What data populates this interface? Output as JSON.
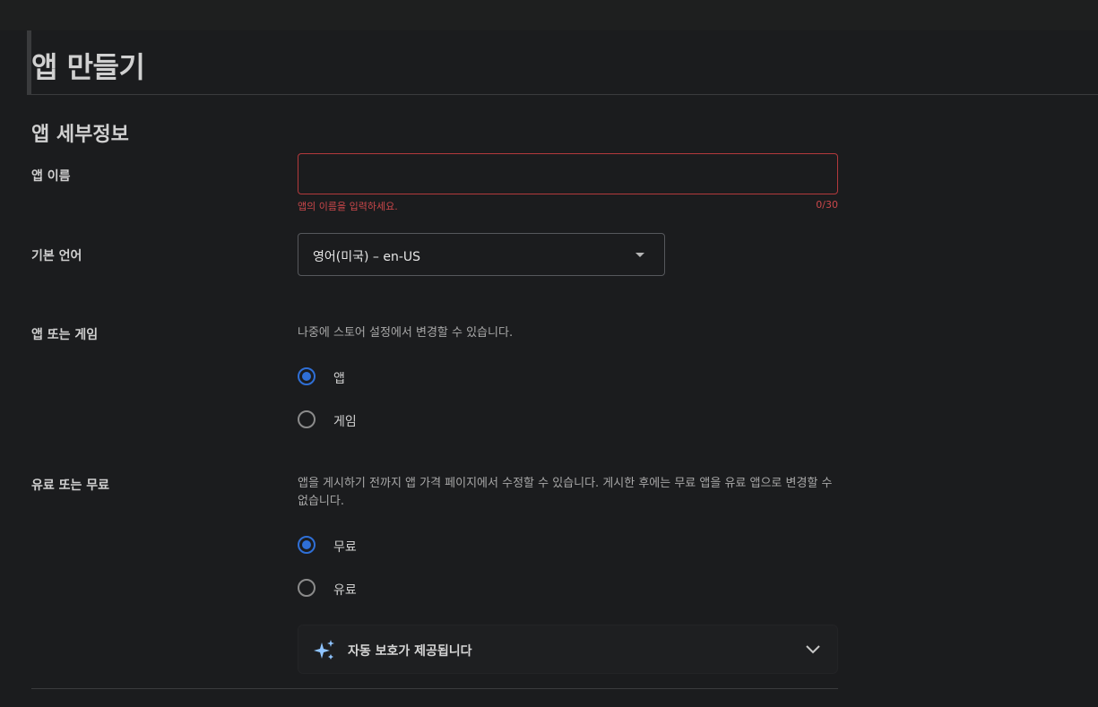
{
  "page": {
    "title": "앱 만들기"
  },
  "section": {
    "title": "앱 세부정보"
  },
  "app_name": {
    "label": "앱 이름",
    "value": "",
    "error": "앱의 이름을 입력하세요.",
    "counter": "0/30"
  },
  "default_language": {
    "label": "기본 언어",
    "selected": "영어(미국) – en-US"
  },
  "app_or_game": {
    "label": "앱 또는 게임",
    "helper": "나중에 스토어 설정에서 변경할 수 있습니다.",
    "options": [
      {
        "label": "앱",
        "checked": true
      },
      {
        "label": "게임",
        "checked": false
      }
    ]
  },
  "free_or_paid": {
    "label": "유료 또는 무료",
    "helper": "앱을 게시하기 전까지 앱 가격 페이지에서 수정할 수 있습니다. 게시한 후에는 무료 앱을 유료 앱으로 변경할 수 없습니다.",
    "options": [
      {
        "label": "무료",
        "checked": true
      },
      {
        "label": "유료",
        "checked": false
      }
    ]
  },
  "auto_protection": {
    "label": "자동 보호가 제공됩니다",
    "icon": "sparkle-icon"
  },
  "colors": {
    "accent": "#2f6fd6",
    "error": "#c9474a",
    "background": "#1b1c1e"
  }
}
